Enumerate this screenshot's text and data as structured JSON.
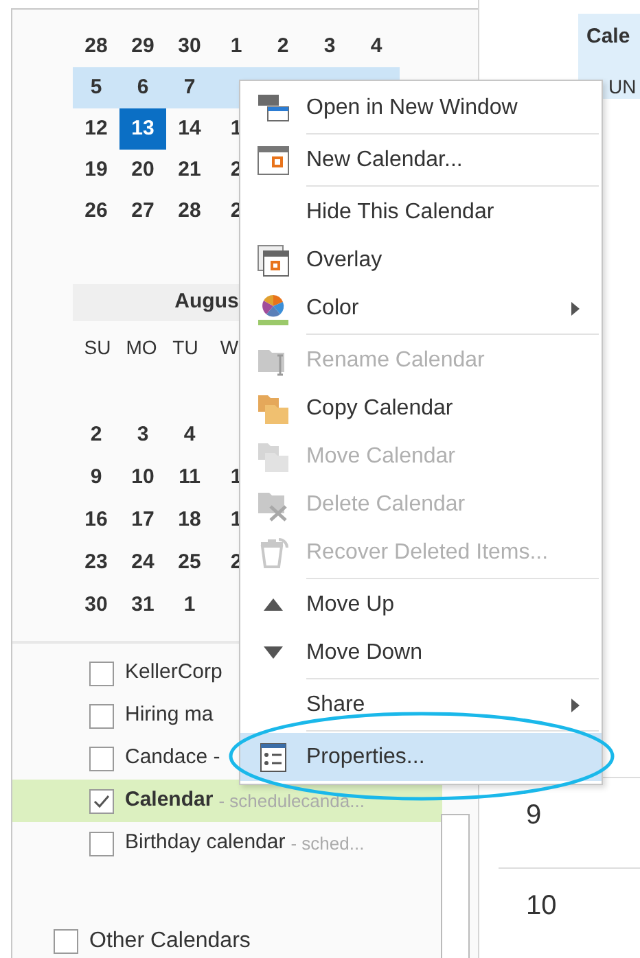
{
  "month_1": {
    "weeks": [
      {
        "highlighted": false,
        "days": [
          {
            "label": "28",
            "selected": false
          },
          {
            "label": "29",
            "selected": false
          },
          {
            "label": "30",
            "selected": false
          },
          {
            "label": "1",
            "selected": false
          },
          {
            "label": "2",
            "selected": false
          },
          {
            "label": "3",
            "selected": false
          },
          {
            "label": "4",
            "selected": false
          }
        ]
      },
      {
        "highlighted": true,
        "days": [
          {
            "label": "5",
            "selected": false
          },
          {
            "label": "6",
            "selected": false
          },
          {
            "label": "7",
            "selected": false
          }
        ]
      },
      {
        "highlighted": false,
        "days": [
          {
            "label": "12",
            "selected": false
          },
          {
            "label": "13",
            "selected": true
          },
          {
            "label": "14",
            "selected": false
          },
          {
            "label": "1",
            "selected": false
          }
        ]
      },
      {
        "highlighted": false,
        "days": [
          {
            "label": "19",
            "selected": false
          },
          {
            "label": "20",
            "selected": false
          },
          {
            "label": "21",
            "selected": false
          },
          {
            "label": "2",
            "selected": false
          }
        ]
      },
      {
        "highlighted": false,
        "days": [
          {
            "label": "26",
            "selected": false
          },
          {
            "label": "27",
            "selected": false
          },
          {
            "label": "28",
            "selected": false
          },
          {
            "label": "2",
            "selected": false
          }
        ]
      }
    ]
  },
  "month_2": {
    "title": "Augus",
    "weekdays": [
      "SU",
      "MO",
      "TU",
      "W"
    ],
    "weeks": [
      {
        "days": [
          "2",
          "3",
          "4"
        ]
      },
      {
        "days": [
          "9",
          "10",
          "11",
          "1"
        ]
      },
      {
        "days": [
          "16",
          "17",
          "18",
          "1"
        ]
      },
      {
        "days": [
          "23",
          "24",
          "25",
          "2"
        ]
      },
      {
        "days": [
          "30",
          "31",
          "1"
        ]
      }
    ]
  },
  "calendars": [
    {
      "name": "KellerCorp",
      "checked": false,
      "selected": false
    },
    {
      "name": "Hiring ma",
      "checked": false,
      "selected": false
    },
    {
      "name": "Candace -",
      "checked": false,
      "selected": false
    },
    {
      "name": "Calendar",
      "detail": "- schedulecanda...",
      "checked": true,
      "selected": true
    },
    {
      "name": "Birthday calendar",
      "detail": "- sched...",
      "checked": false,
      "selected": false
    }
  ],
  "other_calendars": {
    "label": "Other Calendars",
    "checked": false
  },
  "right_pane": {
    "header": "Cale",
    "day": "UN",
    "hours": [
      "9",
      "10"
    ]
  },
  "context_menu": [
    {
      "kind": "item",
      "label": "Open in New Window",
      "disabled": false,
      "submenu": false,
      "selected": false
    },
    {
      "kind": "separator"
    },
    {
      "kind": "item",
      "label": "New Calendar...",
      "disabled": false,
      "submenu": false,
      "selected": false
    },
    {
      "kind": "separator"
    },
    {
      "kind": "item",
      "label": "Hide This Calendar",
      "disabled": false,
      "submenu": false,
      "selected": false
    },
    {
      "kind": "item",
      "label": "Overlay",
      "disabled": false,
      "submenu": false,
      "selected": false
    },
    {
      "kind": "item",
      "label": "Color",
      "disabled": false,
      "submenu": true,
      "selected": false
    },
    {
      "kind": "separator"
    },
    {
      "kind": "item",
      "label": "Rename Calendar",
      "disabled": true,
      "submenu": false,
      "selected": false
    },
    {
      "kind": "item",
      "label": "Copy Calendar",
      "disabled": false,
      "submenu": false,
      "selected": false
    },
    {
      "kind": "item",
      "label": "Move Calendar",
      "disabled": true,
      "submenu": false,
      "selected": false
    },
    {
      "kind": "item",
      "label": "Delete Calendar",
      "disabled": true,
      "submenu": false,
      "selected": false
    },
    {
      "kind": "item",
      "label": "Recover Deleted Items...",
      "disabled": true,
      "submenu": false,
      "selected": false
    },
    {
      "kind": "separator"
    },
    {
      "kind": "item",
      "label": "Move Up",
      "disabled": false,
      "submenu": false,
      "selected": false
    },
    {
      "kind": "item",
      "label": "Move Down",
      "disabled": false,
      "submenu": false,
      "selected": false
    },
    {
      "kind": "separator"
    },
    {
      "kind": "item",
      "label": "Share",
      "disabled": false,
      "submenu": true,
      "selected": false
    },
    {
      "kind": "separator"
    },
    {
      "kind": "item",
      "label": "Properties...",
      "disabled": false,
      "submenu": false,
      "selected": true
    }
  ],
  "highlight_ellipse": true
}
